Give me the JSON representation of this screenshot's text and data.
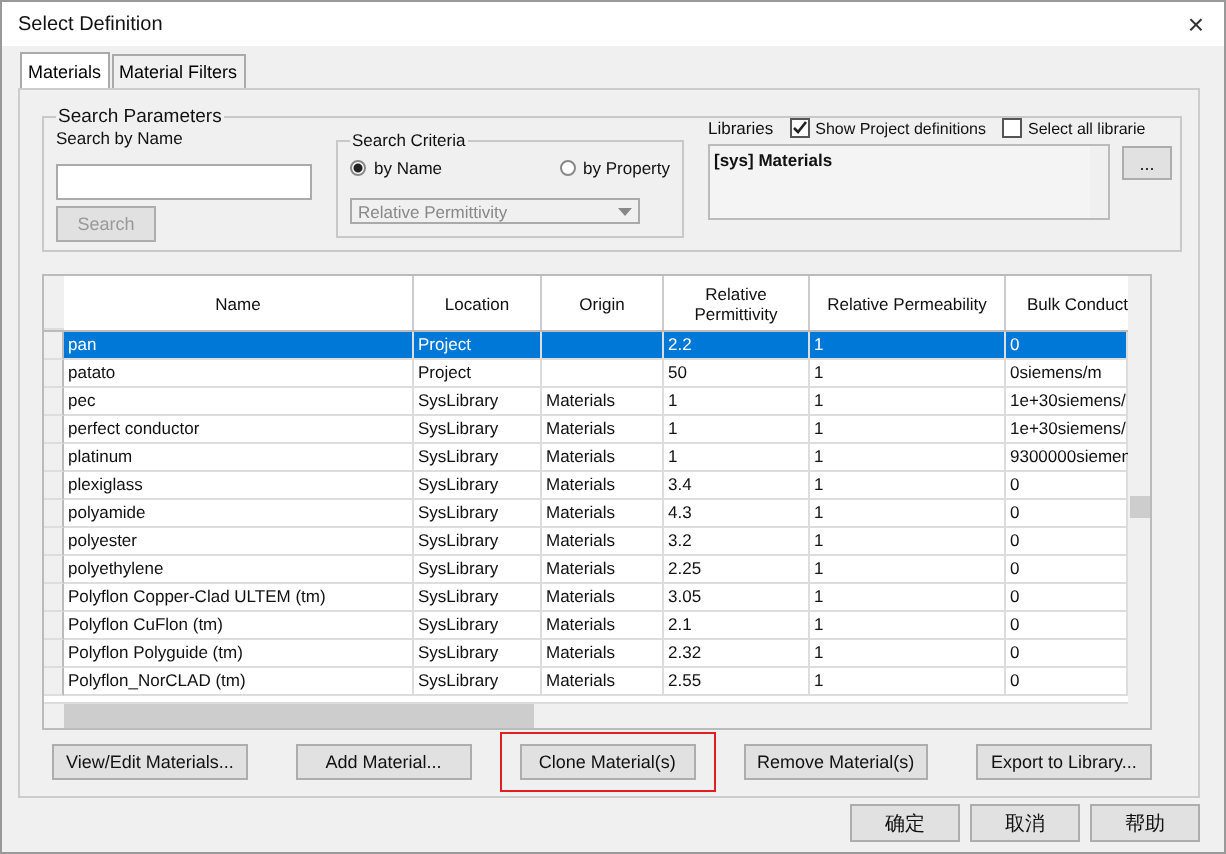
{
  "window": {
    "title": "Select Definition",
    "close": "×"
  },
  "tabs": [
    {
      "label": "Materials",
      "selected": true
    },
    {
      "label": "Material Filters",
      "selected": false
    }
  ],
  "search_parameters": {
    "title": "Search Parameters",
    "search_by_name_label": "Search by Name",
    "search_button": {
      "label": "Search",
      "disabled": true
    },
    "criteria": {
      "title": "Search Criteria",
      "options": [
        {
          "label": "by Name",
          "selected": true
        },
        {
          "label": "by Property",
          "selected": false
        }
      ],
      "property_dropdown": {
        "value": "Relative Permittivity",
        "disabled": true
      }
    },
    "libraries": {
      "label": "Libraries",
      "checkboxes": [
        {
          "label": "Show Project definitions",
          "checked": true
        },
        {
          "label": "Select all librarie",
          "checked": false
        }
      ],
      "items": [
        "[sys] Materials"
      ],
      "browse_button": "..."
    }
  },
  "table": {
    "columns": [
      "Name",
      "Location",
      "Origin",
      "Relative Permittivity",
      "Relative Permeability",
      "Bulk Conduct"
    ],
    "rows": [
      {
        "cells": [
          "pan",
          "Project",
          "",
          "2.2",
          "1",
          "0"
        ],
        "selected": true
      },
      {
        "cells": [
          "patato",
          "Project",
          "",
          "50",
          "1",
          "0siemens/m"
        ],
        "selected": false
      },
      {
        "cells": [
          "pec",
          "SysLibrary",
          "Materials",
          "1",
          "1",
          "1e+30siemens/"
        ],
        "selected": false
      },
      {
        "cells": [
          "perfect conductor",
          "SysLibrary",
          "Materials",
          "1",
          "1",
          "1e+30siemens/"
        ],
        "selected": false
      },
      {
        "cells": [
          "platinum",
          "SysLibrary",
          "Materials",
          "1",
          "1",
          "9300000siemen"
        ],
        "selected": false
      },
      {
        "cells": [
          "plexiglass",
          "SysLibrary",
          "Materials",
          "3.4",
          "1",
          "0"
        ],
        "selected": false
      },
      {
        "cells": [
          "polyamide",
          "SysLibrary",
          "Materials",
          "4.3",
          "1",
          "0"
        ],
        "selected": false
      },
      {
        "cells": [
          "polyester",
          "SysLibrary",
          "Materials",
          "3.2",
          "1",
          "0"
        ],
        "selected": false
      },
      {
        "cells": [
          "polyethylene",
          "SysLibrary",
          "Materials",
          "2.25",
          "1",
          "0"
        ],
        "selected": false
      },
      {
        "cells": [
          "Polyflon Copper-Clad ULTEM (tm)",
          "SysLibrary",
          "Materials",
          "3.05",
          "1",
          "0"
        ],
        "selected": false
      },
      {
        "cells": [
          "Polyflon CuFlon (tm)",
          "SysLibrary",
          "Materials",
          "2.1",
          "1",
          "0"
        ],
        "selected": false
      },
      {
        "cells": [
          "Polyflon Polyguide (tm)",
          "SysLibrary",
          "Materials",
          "2.32",
          "1",
          "0"
        ],
        "selected": false
      },
      {
        "cells": [
          "Polyflon_NorCLAD (tm)",
          "SysLibrary",
          "Materials",
          "2.55",
          "1",
          "0"
        ],
        "selected": false
      }
    ]
  },
  "action_buttons": [
    {
      "label": "View/Edit Materials...",
      "highlighted": false
    },
    {
      "label": "Add Material...",
      "highlighted": false
    },
    {
      "label": "Clone Material(s)",
      "highlighted": true
    },
    {
      "label": "Remove Material(s)",
      "highlighted": false
    },
    {
      "label": "Export to Library...",
      "highlighted": false
    }
  ],
  "dialog_buttons": [
    "确定",
    "取消",
    "帮助"
  ]
}
